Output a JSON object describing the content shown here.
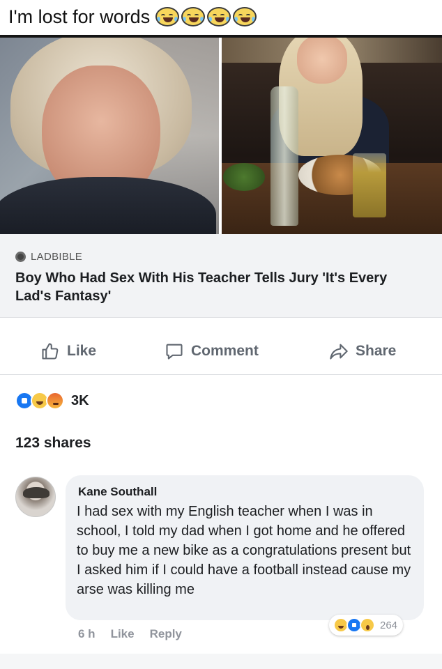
{
  "caption": {
    "text": "I'm lost for words",
    "emojis": [
      "tears-of-joy-icon",
      "tears-of-joy-icon",
      "tears-of-joy-icon",
      "tears-of-joy-icon"
    ]
  },
  "link": {
    "source": "LADBIBLE",
    "headline": "Boy Who Had Sex With His Teacher Tells Jury 'It's Every Lad's Fantasy'"
  },
  "actions": {
    "like": "Like",
    "comment": "Comment",
    "share": "Share"
  },
  "reactions": {
    "types": [
      "like-reaction-icon",
      "haha-reaction-icon",
      "angry-reaction-icon"
    ],
    "count": "3K"
  },
  "shares": "123 shares",
  "comment": {
    "author": "Kane Southall",
    "text": "I had sex with my English teacher when I was in school, I told my dad when I got home and he offered to buy me a new bike as a congratulations present but I asked him if I could have a football instead cause my arse was killing me",
    "time": "6 h",
    "like": "Like",
    "reply": "Reply",
    "reaction_types": [
      "haha-reaction-icon",
      "like-reaction-icon",
      "wow-reaction-icon"
    ],
    "reaction_count": "264"
  },
  "colors": {
    "link_box_bg": "#f2f3f5",
    "bubble_bg": "#f0f2f5",
    "action_text": "#606770",
    "facebook_blue": "#1877f2"
  }
}
